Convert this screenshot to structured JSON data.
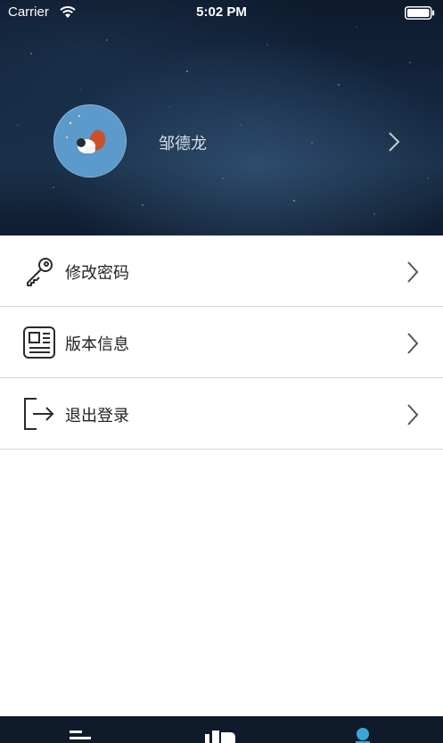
{
  "status_bar": {
    "carrier": "Carrier",
    "time": "5:02 PM"
  },
  "profile": {
    "name": "邹德龙"
  },
  "menu": {
    "items": [
      {
        "label": "修改密码",
        "icon": "key-icon"
      },
      {
        "label": "版本信息",
        "icon": "news-icon"
      },
      {
        "label": "退出登录",
        "icon": "logout-icon"
      }
    ]
  },
  "tabbar": {
    "tabs": [
      {
        "icon": "list-icon",
        "active": false
      },
      {
        "icon": "stats-icon",
        "active": false
      },
      {
        "icon": "person-icon",
        "active": true
      }
    ],
    "active_color": "#3aa6d8"
  },
  "colors": {
    "header_bg": "#142740",
    "divider": "#d4d4d4",
    "text": "#222222"
  }
}
